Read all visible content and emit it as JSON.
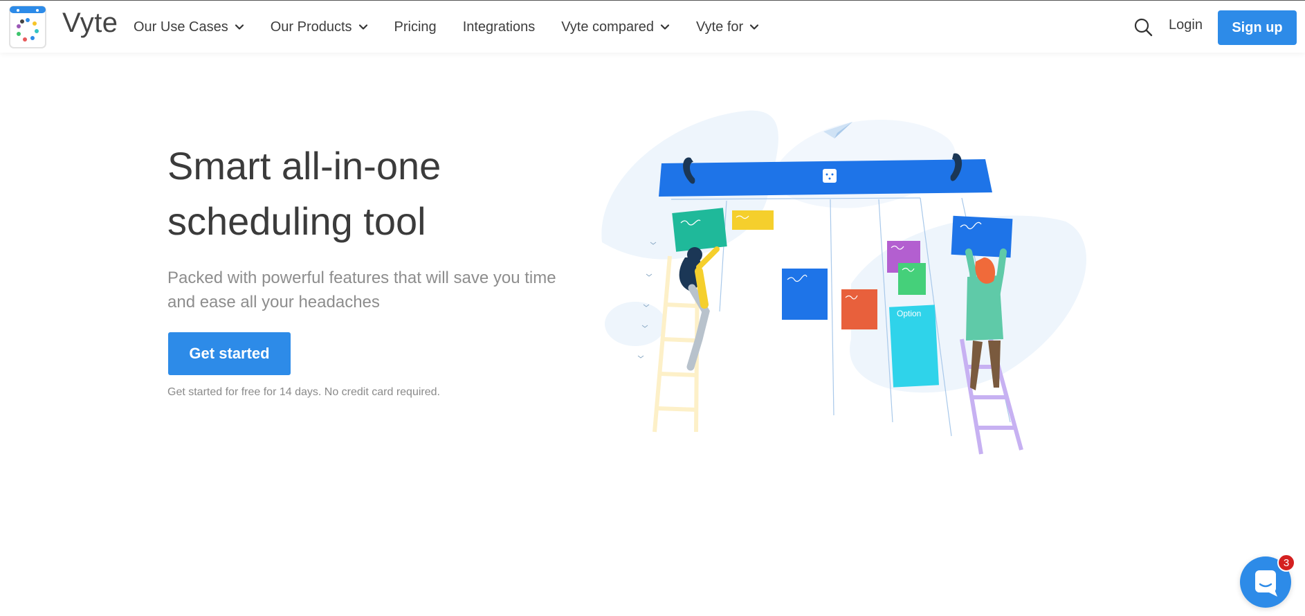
{
  "header": {
    "brand": "Vyte",
    "nav": [
      {
        "label": "Our Use Cases",
        "dropdown": true
      },
      {
        "label": "Our Products",
        "dropdown": true
      },
      {
        "label": "Pricing",
        "dropdown": false
      },
      {
        "label": "Integrations",
        "dropdown": false
      },
      {
        "label": "Vyte compared",
        "dropdown": true
      },
      {
        "label": "Vyte for",
        "dropdown": true
      }
    ],
    "login": "Login",
    "signup": "Sign up"
  },
  "hero": {
    "title_line1": "Smart all-in-one",
    "title_line2": "scheduling tool",
    "subtitle_line1": "Packed with powerful features that will save you time",
    "subtitle_line2": "and ease all your headaches",
    "cta": "Get started",
    "note": "Get started for free for 14 days. No credit card required."
  },
  "illustration": {
    "card_label": "Option"
  },
  "chat": {
    "badge_count": "3"
  },
  "colors": {
    "primary": "#2d8be8",
    "board": "#1e74e8",
    "badge": "#d42020"
  }
}
